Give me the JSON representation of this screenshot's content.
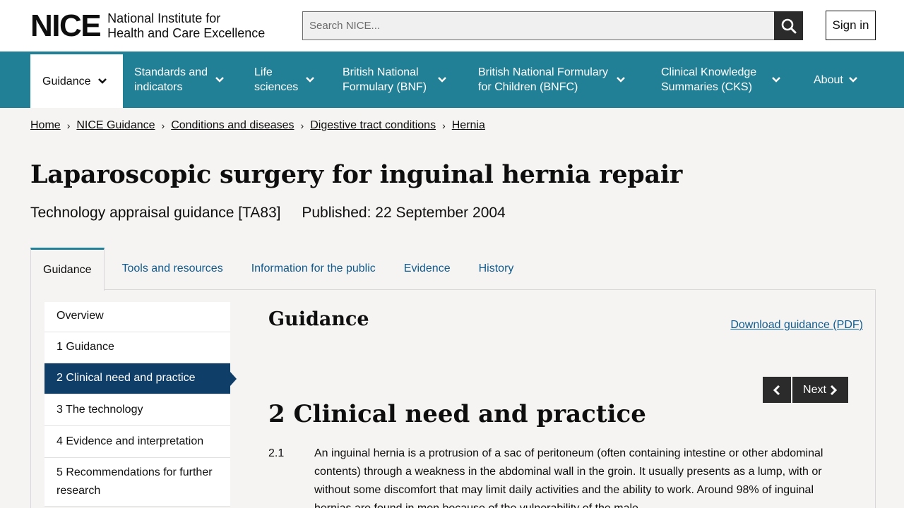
{
  "header": {
    "logo_mark": "NICE",
    "logo_line1": "National Institute for",
    "logo_line2": "Health and Care Excellence",
    "search_placeholder": "Search NICE...",
    "sign_in": "Sign in"
  },
  "nav": {
    "items": [
      {
        "label": "Guidance"
      },
      {
        "label": "Standards and\nindicators"
      },
      {
        "label": "Life\nsciences"
      },
      {
        "label": "British National\nFormulary (BNF)"
      },
      {
        "label": "British National Formulary\nfor Children (BNFC)"
      },
      {
        "label": "Clinical Knowledge\nSummaries (CKS)"
      },
      {
        "label": "About"
      }
    ]
  },
  "breadcrumb": [
    "Home",
    "NICE Guidance",
    "Conditions and diseases",
    "Digestive tract conditions",
    "Hernia"
  ],
  "page": {
    "title": "Laparoscopic surgery for inguinal hernia repair",
    "type": "Technology appraisal guidance [TA83]",
    "published": "Published: 22 September 2004"
  },
  "tabs": [
    "Guidance",
    "Tools and resources",
    "Information for the public",
    "Evidence",
    "History"
  ],
  "sidenav": [
    "Overview",
    "1 Guidance",
    "2 Clinical need and practice",
    "3 The technology",
    "4 Evidence and interpretation",
    "5 Recommendations for further research"
  ],
  "content": {
    "heading": "Guidance",
    "download": "Download guidance (PDF)",
    "next": "Next",
    "chapter_title": "2 Clinical need and practice",
    "para_num": "2.1",
    "para_text": "An inguinal hernia is a protrusion of a sac of peritoneum (often containing intestine or other abdominal contents) through a weakness in the abdominal wall in the groin. It usually presents as a lump, with or without some discomfort that may limit daily activities and the ability to work. Around 98% of inguinal hernias are found in men because of the vulnerability of the male"
  },
  "colors": {
    "nav_bg": "#228096",
    "active_side": "#0f3e68",
    "link": "#0f5a8e"
  }
}
